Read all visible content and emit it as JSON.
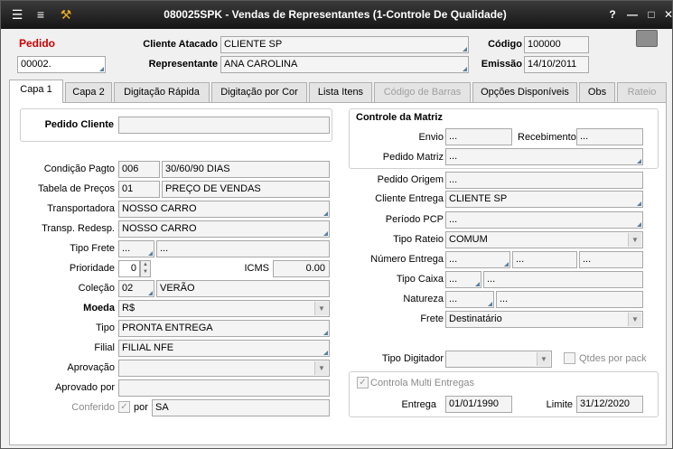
{
  "window": {
    "title": "080025SPK - Vendas de Representantes (1-Controle De Qualidade)"
  },
  "header": {
    "pedido_label": "Pedido",
    "pedido_value": "00002.",
    "cliente_label": "Cliente Atacado",
    "cliente_value": "CLIENTE SP",
    "rep_label": "Representante",
    "rep_value": "ANA CAROLINA",
    "codigo_label": "Código",
    "codigo_value": "100000",
    "emissao_label": "Emissão",
    "emissao_value": "14/10/2011"
  },
  "tabs": [
    "Capa 1",
    "Capa 2",
    "Digitação Rápida",
    "Digitação por Cor",
    "Lista Itens",
    "Código de Barras",
    "Opções Disponíveis",
    "Obs",
    "Rateio"
  ],
  "left": {
    "pedido_cliente_label": "Pedido Cliente",
    "pedido_cliente_value": "",
    "cond_label": "Condição Pagto",
    "cond_code": "006",
    "cond_desc": "30/60/90 DIAS",
    "tabela_label": "Tabela de Preços",
    "tabela_code": "01",
    "tabela_desc": "PREÇO DE VENDAS",
    "transp_label": "Transportadora",
    "transp_value": "NOSSO CARRO",
    "redesp_label": "Transp. Redesp.",
    "redesp_value": "NOSSO CARRO",
    "frete_label": "Tipo Frete",
    "frete_code": "...",
    "frete_desc": "...",
    "prioridade_label": "Prioridade",
    "prioridade_value": "0",
    "icms_label": "ICMS",
    "icms_value": "0.00",
    "colecao_label": "Coleção",
    "colecao_code": "02",
    "colecao_desc": "VERÃO",
    "moeda_label": "Moeda",
    "moeda_value": "R$",
    "tipo_label": "Tipo",
    "tipo_value": "PRONTA ENTREGA",
    "filial_label": "Filial",
    "filial_value": "FILIAL NFE",
    "aprovacao_label": "Aprovação",
    "aprovacao_value": "",
    "aprovado_label": "Aprovado por",
    "aprovado_value": "",
    "conferido_label": "Conferido",
    "por_label": "por",
    "por_value": "SA"
  },
  "right": {
    "controle_title": "Controle da Matriz",
    "envio_label": "Envio",
    "envio_value": "...",
    "receb_label": "Recebimento",
    "receb_value": "...",
    "pedmatriz_label": "Pedido Matriz",
    "pedmatriz_value": "...",
    "origem_label": "Pedido Origem",
    "origem_value": "...",
    "clientent_label": "Cliente Entrega",
    "clientent_value": "CLIENTE SP",
    "pcp_label": "Período PCP",
    "pcp_value": "...",
    "rateio_label": "Tipo Rateio",
    "rateio_value": "COMUM",
    "nument_label": "Número Entrega",
    "nument_1": "...",
    "nument_2": "...",
    "nument_3": "...",
    "caixa_label": "Tipo Caixa",
    "caixa_code": "...",
    "caixa_desc": "...",
    "natureza_label": "Natureza",
    "natureza_code": "...",
    "natureza_desc": "...",
    "frete_label": "Frete",
    "frete_value": "Destinatário",
    "digitador_label": "Tipo Digitador",
    "digitador_value": "",
    "qtdes_label": "Qtdes por pack",
    "multi_label": "Controla Multi Entregas",
    "entrega_label": "Entrega",
    "entrega_value": "01/01/1990",
    "limite_label": "Limite",
    "limite_value": "31/12/2020"
  }
}
